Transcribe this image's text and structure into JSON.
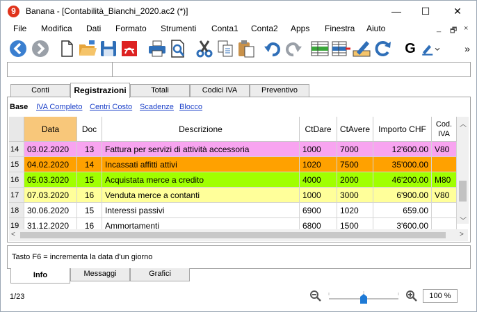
{
  "window": {
    "title": "Banana - [Contabilità_Bianchi_2020.ac2 (*)]",
    "logo": "9"
  },
  "window_buttons": {
    "minimize": "—",
    "maximize": "☐",
    "close": "✕"
  },
  "menu": [
    "File",
    "Modifica",
    "Dati",
    "Formato",
    "Strumenti",
    "Conta1",
    "Conta2",
    "Apps",
    "Finestra",
    "Aiuto"
  ],
  "mdi_buttons": [
    "_",
    "🗗",
    "×"
  ],
  "toolbar_overflow": "»",
  "toolbar_text_g": "G",
  "tabs": [
    "Conti",
    "Registrazioni",
    "Totali",
    "Codici IVA",
    "Preventivo"
  ],
  "active_tab": "Registrazioni",
  "views": [
    "Base",
    "IVA Completo",
    "Centri Costo",
    "Scadenze",
    "Blocco"
  ],
  "columns": {
    "data": "Data",
    "doc": "Doc",
    "descrizione": "Descrizione",
    "ctdare": "CtDare",
    "ctavere": "CtAvere",
    "importo": "Importo CHF",
    "codiva1": "Cod.",
    "codiva2": "IVA"
  },
  "rows": [
    {
      "n": "14",
      "data": "03.02.2020",
      "doc": "13",
      "desc": "Fattura per servizi di attività accessoria",
      "dare": "1000",
      "avere": "7000",
      "importo": "12'600.00",
      "iva": "V80",
      "color": "#f8a4f0"
    },
    {
      "n": "15",
      "data": "04.02.2020",
      "doc": "14",
      "desc": "Incassati affitti attivi",
      "dare": "1020",
      "avere": "7500",
      "importo": "35'000.00",
      "iva": "",
      "color": "#ffa100"
    },
    {
      "n": "16",
      "data": "05.03.2020",
      "doc": "15",
      "desc": "Acquistata merce a credito",
      "dare": "4000",
      "avere": "2000",
      "importo": "46'200.00",
      "iva": "M80",
      "color": "#a0ff00"
    },
    {
      "n": "17",
      "data": "07.03.2020",
      "doc": "16",
      "desc": "Venduta merce a contanti",
      "dare": "1000",
      "avere": "3000",
      "importo": "6'900.00",
      "iva": "V80",
      "color": "#ffff9a"
    },
    {
      "n": "18",
      "data": "30.06.2020",
      "doc": "15",
      "desc": "Interessi passivi",
      "dare": "6900",
      "avere": "1020",
      "importo": "659.00",
      "iva": "",
      "color": "#ffffff"
    },
    {
      "n": "19",
      "data": "31.12.2020",
      "doc": "16",
      "desc": "Ammortamenti",
      "dare": "6800",
      "avere": "1500",
      "importo": "3'600.00",
      "iva": "",
      "color": "#ffffff"
    }
  ],
  "info_text": "Tasto F6 = incrementa la data d'un giorno",
  "bottom_tabs": [
    "Info",
    "Messaggi",
    "Grafici"
  ],
  "status": {
    "count": "1/23",
    "zoom": "100 %",
    "zoom_level_pct": 50
  }
}
